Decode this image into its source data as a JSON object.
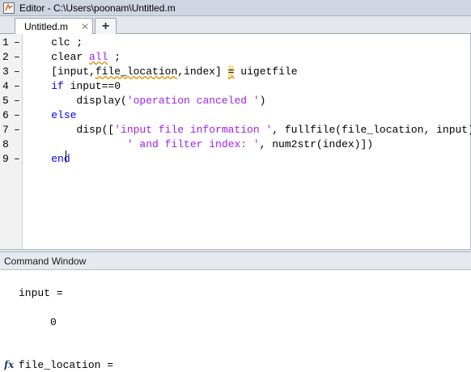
{
  "window": {
    "title": "Editor - C:\\Users\\poonam\\Untitled.m",
    "icon": "matlab-editor-icon"
  },
  "tabs": [
    {
      "label": "Untitled.m",
      "close_icon": "✕"
    }
  ],
  "add_tab_label": "+",
  "editor": {
    "lines": [
      {
        "n": "1",
        "dash": "–",
        "segs": [
          {
            "t": "    clc ;",
            "c": ""
          }
        ]
      },
      {
        "n": "2",
        "dash": "–",
        "segs": [
          {
            "t": "    clear ",
            "c": ""
          },
          {
            "t": "all",
            "c": "str squig"
          },
          {
            "t": " ;",
            "c": ""
          }
        ]
      },
      {
        "n": "3",
        "dash": "–",
        "segs": [
          {
            "t": "    [input,",
            "c": ""
          },
          {
            "t": "file_location",
            "c": "squig"
          },
          {
            "t": ",index] ",
            "c": ""
          },
          {
            "t": "=",
            "c": "hl squig"
          },
          {
            "t": " uigetfile",
            "c": ""
          }
        ]
      },
      {
        "n": "4",
        "dash": "–",
        "segs": [
          {
            "t": "    ",
            "c": ""
          },
          {
            "t": "if",
            "c": "kw"
          },
          {
            "t": " input==0",
            "c": ""
          }
        ]
      },
      {
        "n": "5",
        "dash": "–",
        "segs": [
          {
            "t": "        display(",
            "c": ""
          },
          {
            "t": "'operation canceled '",
            "c": "str"
          },
          {
            "t": ")",
            "c": ""
          }
        ]
      },
      {
        "n": "6",
        "dash": "–",
        "segs": [
          {
            "t": "    ",
            "c": ""
          },
          {
            "t": "else",
            "c": "kw"
          }
        ]
      },
      {
        "n": "7",
        "dash": "–",
        "segs": [
          {
            "t": "        disp([",
            "c": ""
          },
          {
            "t": "'input file information '",
            "c": "str"
          },
          {
            "t": ", fullfile(file_location, input)",
            "c": ""
          }
        ]
      },
      {
        "n": "8",
        "dash": "",
        "segs": [
          {
            "t": "                ",
            "c": ""
          },
          {
            "t": "' and filter index: '",
            "c": "str"
          },
          {
            "t": ", num2str(index)])",
            "c": ""
          }
        ]
      },
      {
        "n": "9",
        "dash": "–",
        "segs": [
          {
            "t": "    ",
            "c": ""
          },
          {
            "t": "end",
            "c": "kw"
          }
        ]
      }
    ]
  },
  "command_window": {
    "title": "Command Window",
    "lines": [
      {
        "text": "input ="
      },
      {
        "text": "     0"
      },
      {
        "text": "file_location ="
      }
    ],
    "prompt_icon": "fx"
  }
}
